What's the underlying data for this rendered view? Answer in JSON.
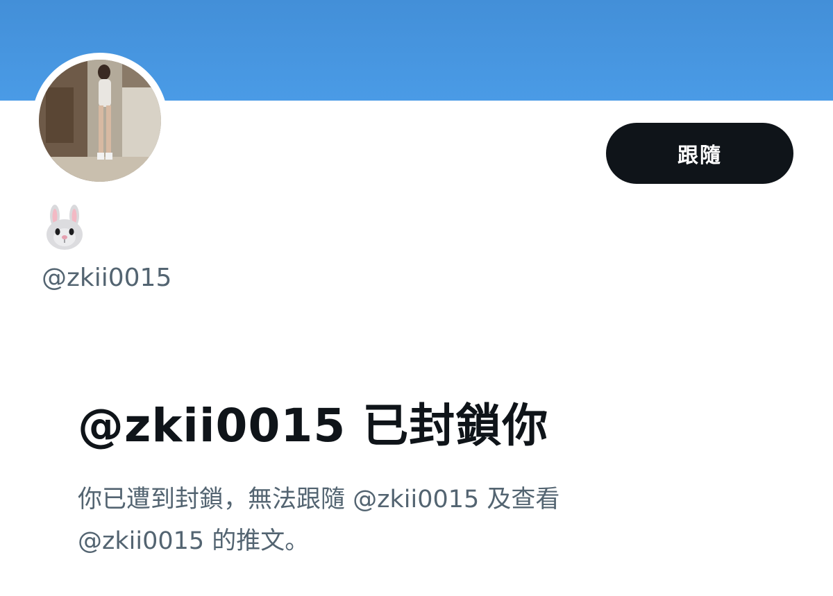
{
  "profile": {
    "display_name_icon": "rabbit-face-emoji",
    "handle": "@zkii0015"
  },
  "actions": {
    "follow_label": "跟隨"
  },
  "blocked_notice": {
    "title": "@zkii0015 已封鎖你",
    "description_line1": "你已遭到封鎖，無法跟隨 @zkii0015 及查看",
    "description_line2": "@zkii0015 的推文。"
  },
  "colors": {
    "banner": "#4a9be6",
    "button_bg": "#0f1419",
    "secondary_text": "#536471",
    "primary_text": "#0f1419"
  }
}
